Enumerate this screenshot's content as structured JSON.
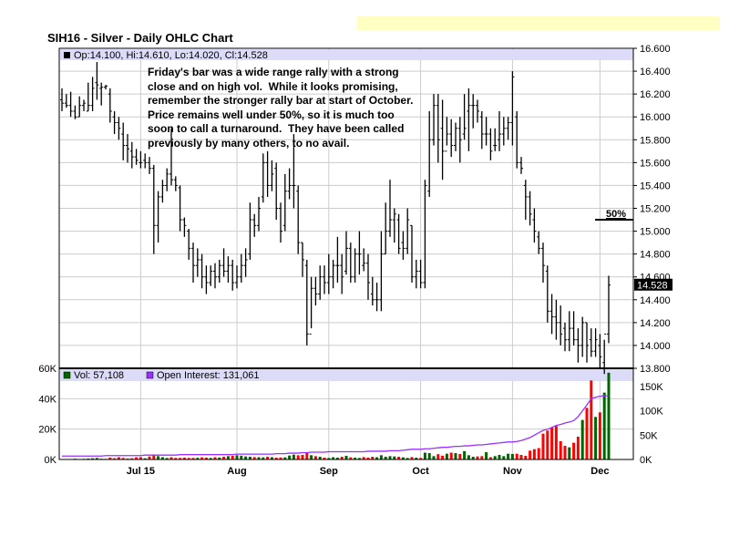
{
  "title": "SIH16 - Silver - Daily OHLC Chart",
  "price_legend": "Op:14.100, Hi:14.610, Lo:14.020, Cl:14.528",
  "annotation": "Friday's bar was a wide range rally with a strong\nclose and on high vol.  While it looks promising,\nremember the stronger rally bar at start of October.\nPrice remains well under 50%, so it is much too\nsoon to call a turnaround.  They have been called\npreviously by many others, to no avail.",
  "fifty_pct_label": "50%",
  "fifty_pct_level": 15.1,
  "last_price_label": "14.528",
  "volume_legend": "Vol: 57,108",
  "oi_legend": "Open Interest: 131,061",
  "colors": {
    "up_volume": "#006400",
    "down_volume": "#ff0000",
    "open_interest": "#9b30ff",
    "legend_bg": "#dcdcf8",
    "grid": "#cccccc",
    "highlight": "#ffffc4"
  },
  "chart_data": [
    {
      "type": "ohlc",
      "title": "SIH16 - Silver - Daily OHLC Chart",
      "ylim": [
        13.8,
        16.6
      ],
      "yticks": [
        "16.600",
        "16.400",
        "16.200",
        "16.000",
        "15.800",
        "15.600",
        "15.400",
        "15.200",
        "15.000",
        "14.800",
        "14.600",
        "14.400",
        "14.200",
        "14.000",
        "13.800"
      ],
      "xtick_labels": [
        "Jul 15",
        "Aug",
        "Sep",
        "Oct",
        "Nov",
        "Dec"
      ],
      "xtick_bar_index": [
        18,
        40,
        61,
        82,
        103,
        123
      ],
      "grid": true,
      "bars_ohlc": [
        [
          16.15,
          16.25,
          16.05,
          16.12
        ],
        [
          16.12,
          16.2,
          16.08,
          16.1
        ],
        [
          16.1,
          16.22,
          16.0,
          16.05
        ],
        [
          16.05,
          16.1,
          15.98,
          16.0
        ],
        [
          16.0,
          16.18,
          16.0,
          16.1
        ],
        [
          16.1,
          16.15,
          16.05,
          16.12
        ],
        [
          16.05,
          16.3,
          16.05,
          16.1
        ],
        [
          16.1,
          16.35,
          16.05,
          16.25
        ],
        [
          16.3,
          16.48,
          16.15,
          16.28
        ],
        [
          16.25,
          16.3,
          16.1,
          16.26
        ],
        [
          16.26,
          16.28,
          16.24,
          16.27
        ],
        [
          16.2,
          16.25,
          15.95,
          16.05
        ],
        [
          16.0,
          16.05,
          15.85,
          15.95
        ],
        [
          15.95,
          16.0,
          15.8,
          15.9
        ],
        [
          15.85,
          15.95,
          15.62,
          15.75
        ],
        [
          15.75,
          15.85,
          15.6,
          15.72
        ],
        [
          15.7,
          15.78,
          15.55,
          15.65
        ],
        [
          15.65,
          15.72,
          15.58,
          15.62
        ],
        [
          15.6,
          15.7,
          15.55,
          15.6
        ],
        [
          15.62,
          15.68,
          15.55,
          15.6
        ],
        [
          15.6,
          15.65,
          15.5,
          15.55
        ],
        [
          15.55,
          15.58,
          14.8,
          15.05
        ],
        [
          15.05,
          15.35,
          14.9,
          15.3
        ],
        [
          15.3,
          15.45,
          15.25,
          15.4
        ],
        [
          15.4,
          15.55,
          15.35,
          15.5
        ],
        [
          15.5,
          15.9,
          15.4,
          15.45
        ],
        [
          15.45,
          15.48,
          15.35,
          15.4
        ],
        [
          15.38,
          15.4,
          15.0,
          15.1
        ],
        [
          15.1,
          15.12,
          14.95,
          15.05
        ],
        [
          15.0,
          15.02,
          14.75,
          14.85
        ],
        [
          14.85,
          14.9,
          14.55,
          14.7
        ],
        [
          14.7,
          14.85,
          14.6,
          14.75
        ],
        [
          14.75,
          14.8,
          14.5,
          14.6
        ],
        [
          14.6,
          14.7,
          14.45,
          14.55
        ],
        [
          14.55,
          14.7,
          14.52,
          14.65
        ],
        [
          14.65,
          14.72,
          14.5,
          14.6
        ],
        [
          14.6,
          14.75,
          14.55,
          14.7
        ],
        [
          14.7,
          14.85,
          14.6,
          14.65
        ],
        [
          14.65,
          14.78,
          14.55,
          14.7
        ],
        [
          14.7,
          14.75,
          14.48,
          14.55
        ],
        [
          14.55,
          14.7,
          14.5,
          14.6
        ],
        [
          14.6,
          14.8,
          14.55,
          14.7
        ],
        [
          14.7,
          14.85,
          14.6,
          14.75
        ],
        [
          14.8,
          15.25,
          14.75,
          15.1
        ],
        [
          15.1,
          15.15,
          14.95,
          15.05
        ],
        [
          15.05,
          15.3,
          15.0,
          15.2
        ],
        [
          15.3,
          15.68,
          15.25,
          15.6
        ],
        [
          15.6,
          15.7,
          15.3,
          15.4
        ],
        [
          15.4,
          15.62,
          15.35,
          15.5
        ],
        [
          15.55,
          15.6,
          15.1,
          15.2
        ],
        [
          15.2,
          15.25,
          14.9,
          15.0
        ],
        [
          15.05,
          15.5,
          15.0,
          15.35
        ],
        [
          15.35,
          15.55,
          15.28,
          15.4
        ],
        [
          15.4,
          15.85,
          15.2,
          15.4
        ],
        [
          15.35,
          15.4,
          14.8,
          14.9
        ],
        [
          14.9,
          14.9,
          14.6,
          14.75
        ],
        [
          14.7,
          14.75,
          14.0,
          14.1
        ],
        [
          14.1,
          14.6,
          14.15,
          14.5
        ],
        [
          14.5,
          14.6,
          14.35,
          14.45
        ],
        [
          14.45,
          14.7,
          14.4,
          14.6
        ],
        [
          14.6,
          14.7,
          14.45,
          14.55
        ],
        [
          14.55,
          14.8,
          14.45,
          14.6
        ],
        [
          14.6,
          14.75,
          14.5,
          14.7
        ],
        [
          14.7,
          14.95,
          14.55,
          14.7
        ],
        [
          14.7,
          14.8,
          14.45,
          14.6
        ],
        [
          14.65,
          15.0,
          14.62,
          14.85
        ],
        [
          14.85,
          14.9,
          14.55,
          14.6
        ],
        [
          14.6,
          14.85,
          14.55,
          14.8
        ],
        [
          14.8,
          15.0,
          14.62,
          14.8
        ],
        [
          14.7,
          14.85,
          14.65,
          14.72
        ],
        [
          14.72,
          14.8,
          14.4,
          14.55
        ],
        [
          14.45,
          14.6,
          14.35,
          14.4
        ],
        [
          14.4,
          14.55,
          14.3,
          14.4
        ],
        [
          14.4,
          15.0,
          14.3,
          14.8
        ],
        [
          14.8,
          15.25,
          14.8,
          15.0
        ],
        [
          15.0,
          15.45,
          14.95,
          15.1
        ],
        [
          15.1,
          15.2,
          14.9,
          15.15
        ],
        [
          15.1,
          15.15,
          14.8,
          14.85
        ],
        [
          14.9,
          15.0,
          14.75,
          14.85
        ],
        [
          14.85,
          15.2,
          14.8,
          15.1
        ],
        [
          15.05,
          15.05,
          14.55,
          14.6
        ],
        [
          14.6,
          14.75,
          14.5,
          14.65
        ],
        [
          14.65,
          14.75,
          14.5,
          14.55
        ],
        [
          14.55,
          15.45,
          14.5,
          15.4
        ],
        [
          15.35,
          16.05,
          15.3,
          15.8
        ],
        [
          15.8,
          16.2,
          15.75,
          16.1
        ],
        [
          16.1,
          16.2,
          15.6,
          15.8
        ],
        [
          15.9,
          16.15,
          15.45,
          15.7
        ],
        [
          15.7,
          16.0,
          15.75,
          15.85
        ],
        [
          15.85,
          15.98,
          15.65,
          15.75
        ],
        [
          15.75,
          15.95,
          15.7,
          15.9
        ],
        [
          15.9,
          16.0,
          15.6,
          15.8
        ],
        [
          15.85,
          16.2,
          15.8,
          15.9
        ],
        [
          16.05,
          16.25,
          15.7,
          16.1
        ],
        [
          16.1,
          16.2,
          15.9,
          16.1
        ],
        [
          16.1,
          16.15,
          15.95,
          16.05
        ],
        [
          16.0,
          16.05,
          15.72,
          15.85
        ],
        [
          15.85,
          16.0,
          15.75,
          15.85
        ],
        [
          15.85,
          15.9,
          15.62,
          15.7
        ],
        [
          15.75,
          15.9,
          15.7,
          15.75
        ],
        [
          15.8,
          16.05,
          15.7,
          15.85
        ],
        [
          15.85,
          16.0,
          15.75,
          15.9
        ],
        [
          15.9,
          16.0,
          15.8,
          15.95
        ],
        [
          15.95,
          16.4,
          15.75,
          16.35
        ],
        [
          16.0,
          16.05,
          15.55,
          15.6
        ],
        [
          15.6,
          15.65,
          15.5,
          15.55
        ],
        [
          15.4,
          15.45,
          15.1,
          15.3
        ],
        [
          15.3,
          15.35,
          15.05,
          15.15
        ],
        [
          15.1,
          15.2,
          14.9,
          15.0
        ],
        [
          14.95,
          15.0,
          14.8,
          14.85
        ],
        [
          14.85,
          14.9,
          14.55,
          14.7
        ],
        [
          14.65,
          14.7,
          14.2,
          14.3
        ],
        [
          14.3,
          14.45,
          14.1,
          14.25
        ],
        [
          14.25,
          14.4,
          14.05,
          14.2
        ],
        [
          14.2,
          14.35,
          14.0,
          14.1
        ],
        [
          14.15,
          14.2,
          13.95,
          14.05
        ],
        [
          14.05,
          14.3,
          13.95,
          14.15
        ],
        [
          14.15,
          14.3,
          14.0,
          14.05
        ],
        [
          14.05,
          14.15,
          13.85,
          14.0
        ],
        [
          14.0,
          14.25,
          13.9,
          14.2
        ],
        [
          14.2,
          14.2,
          13.85,
          14.0
        ],
        [
          14.05,
          14.15,
          13.9,
          13.95
        ],
        [
          13.95,
          14.15,
          13.9,
          14.05
        ],
        [
          14.0,
          14.1,
          13.8,
          13.9
        ],
        [
          13.85,
          14.05,
          13.75,
          14.1
        ],
        [
          14.1,
          14.61,
          14.02,
          14.528
        ]
      ]
    },
    {
      "type": "bar",
      "series": [
        {
          "name": "Vol",
          "unit": "K",
          "values": [
            0.3,
            0.2,
            0.3,
            0.5,
            0.3,
            0.4,
            0.6,
            0.8,
            1.0,
            0.5,
            0.4,
            1.2,
            0.8,
            1.5,
            1.0,
            0.6,
            0.8,
            1.4,
            1.5,
            0.8,
            2.0,
            3.0,
            2.2,
            1.5,
            1.0,
            1.5,
            1.0,
            1.0,
            1.2,
            1.0,
            1.0,
            1.1,
            1.4,
            1.2,
            1.0,
            1.5,
            1.3,
            1.8,
            2.2,
            2.4,
            2.8,
            2.5,
            2.0,
            1.8,
            1.6,
            1.5,
            1.4,
            1.8,
            1.5,
            1.2,
            1.3,
            1.4,
            2.6,
            3.2,
            2.8,
            3.0,
            4.5,
            2.8,
            2.2,
            1.8,
            1.2,
            1.0,
            1.5,
            1.2,
            1.8,
            2.4,
            1.4,
            1.2,
            1.0,
            1.6,
            1.2,
            1.8,
            1.5,
            2.8,
            1.8,
            2.2,
            2.0,
            1.8,
            1.4,
            1.0,
            1.6,
            1.2,
            1.0,
            4.5,
            4.2,
            2.2,
            3.5,
            2.5,
            3.8,
            4.5,
            4.2,
            3.6,
            5.5,
            2.8,
            1.8,
            2.0,
            2.2,
            4.8,
            1.5,
            2.2,
            3.0,
            2.2,
            3.8,
            3.6,
            3.8,
            3.0,
            2.4,
            5.8,
            6.8,
            7.5,
            17,
            19,
            21,
            22,
            12,
            9,
            8,
            11,
            15,
            26,
            34,
            52,
            28,
            31,
            44,
            57.108
          ]
        },
        {
          "name": "Open Interest",
          "unit": "K",
          "type": "line",
          "values": [
            7,
            7,
            7,
            7,
            7,
            7,
            7,
            7,
            7,
            7,
            8,
            8,
            8,
            8,
            8,
            8,
            8,
            8,
            8,
            9,
            9,
            9,
            9,
            9,
            9,
            9,
            9,
            10,
            10,
            10,
            10,
            10,
            10,
            10,
            10,
            10,
            10,
            10,
            10,
            10,
            11,
            11,
            11,
            11,
            11,
            11,
            11,
            11,
            11,
            12,
            12,
            12,
            13,
            13,
            13,
            14,
            14,
            15,
            15,
            15,
            15,
            16,
            16,
            16,
            16,
            16,
            16,
            16,
            16,
            16,
            17,
            17,
            17,
            17,
            17,
            18,
            18,
            18,
            19,
            20,
            21,
            21,
            21,
            22,
            22,
            23,
            24,
            25,
            25,
            26,
            27,
            27,
            28,
            28,
            29,
            30,
            30,
            31,
            32,
            33,
            34,
            35,
            36,
            36,
            37,
            39,
            42,
            45,
            50,
            55,
            60,
            62,
            66,
            70,
            72,
            75,
            77,
            80,
            88,
            100,
            112,
            125,
            128,
            130,
            131,
            131.061
          ]
        }
      ],
      "left_yticks": [
        "60K",
        "40K",
        "20K",
        "0K"
      ],
      "left_ylim": [
        0,
        60
      ],
      "right_yticks": [
        "150K",
        "100K",
        "50K",
        "0K"
      ],
      "right_ylim": [
        0,
        187.5
      ]
    }
  ]
}
